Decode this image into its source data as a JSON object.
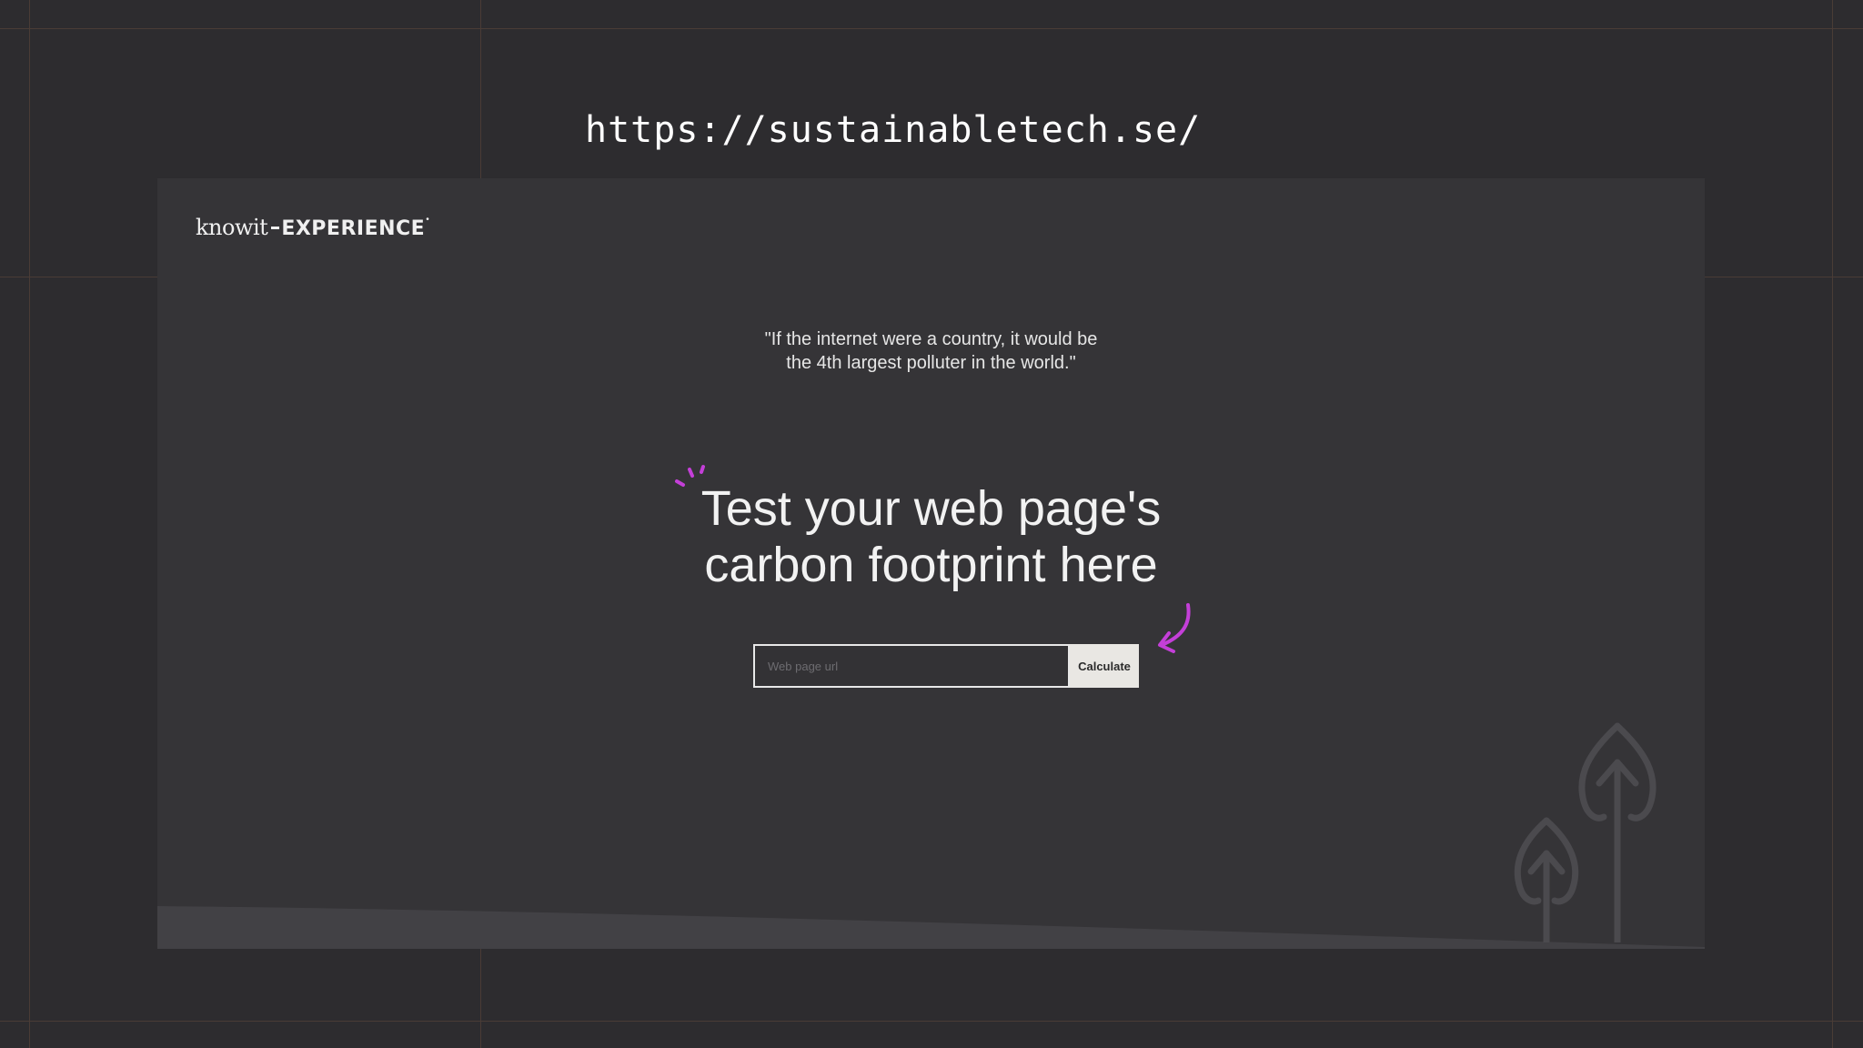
{
  "header": {
    "url_caption": "https://sustainabletech.se/"
  },
  "site": {
    "brand": {
      "knowit": "knowit",
      "experience": "EXPERIENCE",
      "mark": "•"
    },
    "quote": {
      "line1": "\"If the internet were a country, it would be",
      "line2": "the 4th largest polluter in the world.\""
    },
    "headline": {
      "line1": "Test your web page's",
      "line2": "carbon footprint here"
    },
    "form": {
      "input_placeholder": "Web page url",
      "input_value": "",
      "button_label": "Calculate"
    },
    "icons": {
      "sparkle": "sparkle-icon",
      "arrow": "curved-arrow-icon",
      "trees": "tree-arrow-icon"
    }
  },
  "colors": {
    "background": "#2d2c2f",
    "panel": "#353437",
    "accent": "#c43fd8",
    "guide": "#4a3c36",
    "button": "#e9e7e3"
  }
}
